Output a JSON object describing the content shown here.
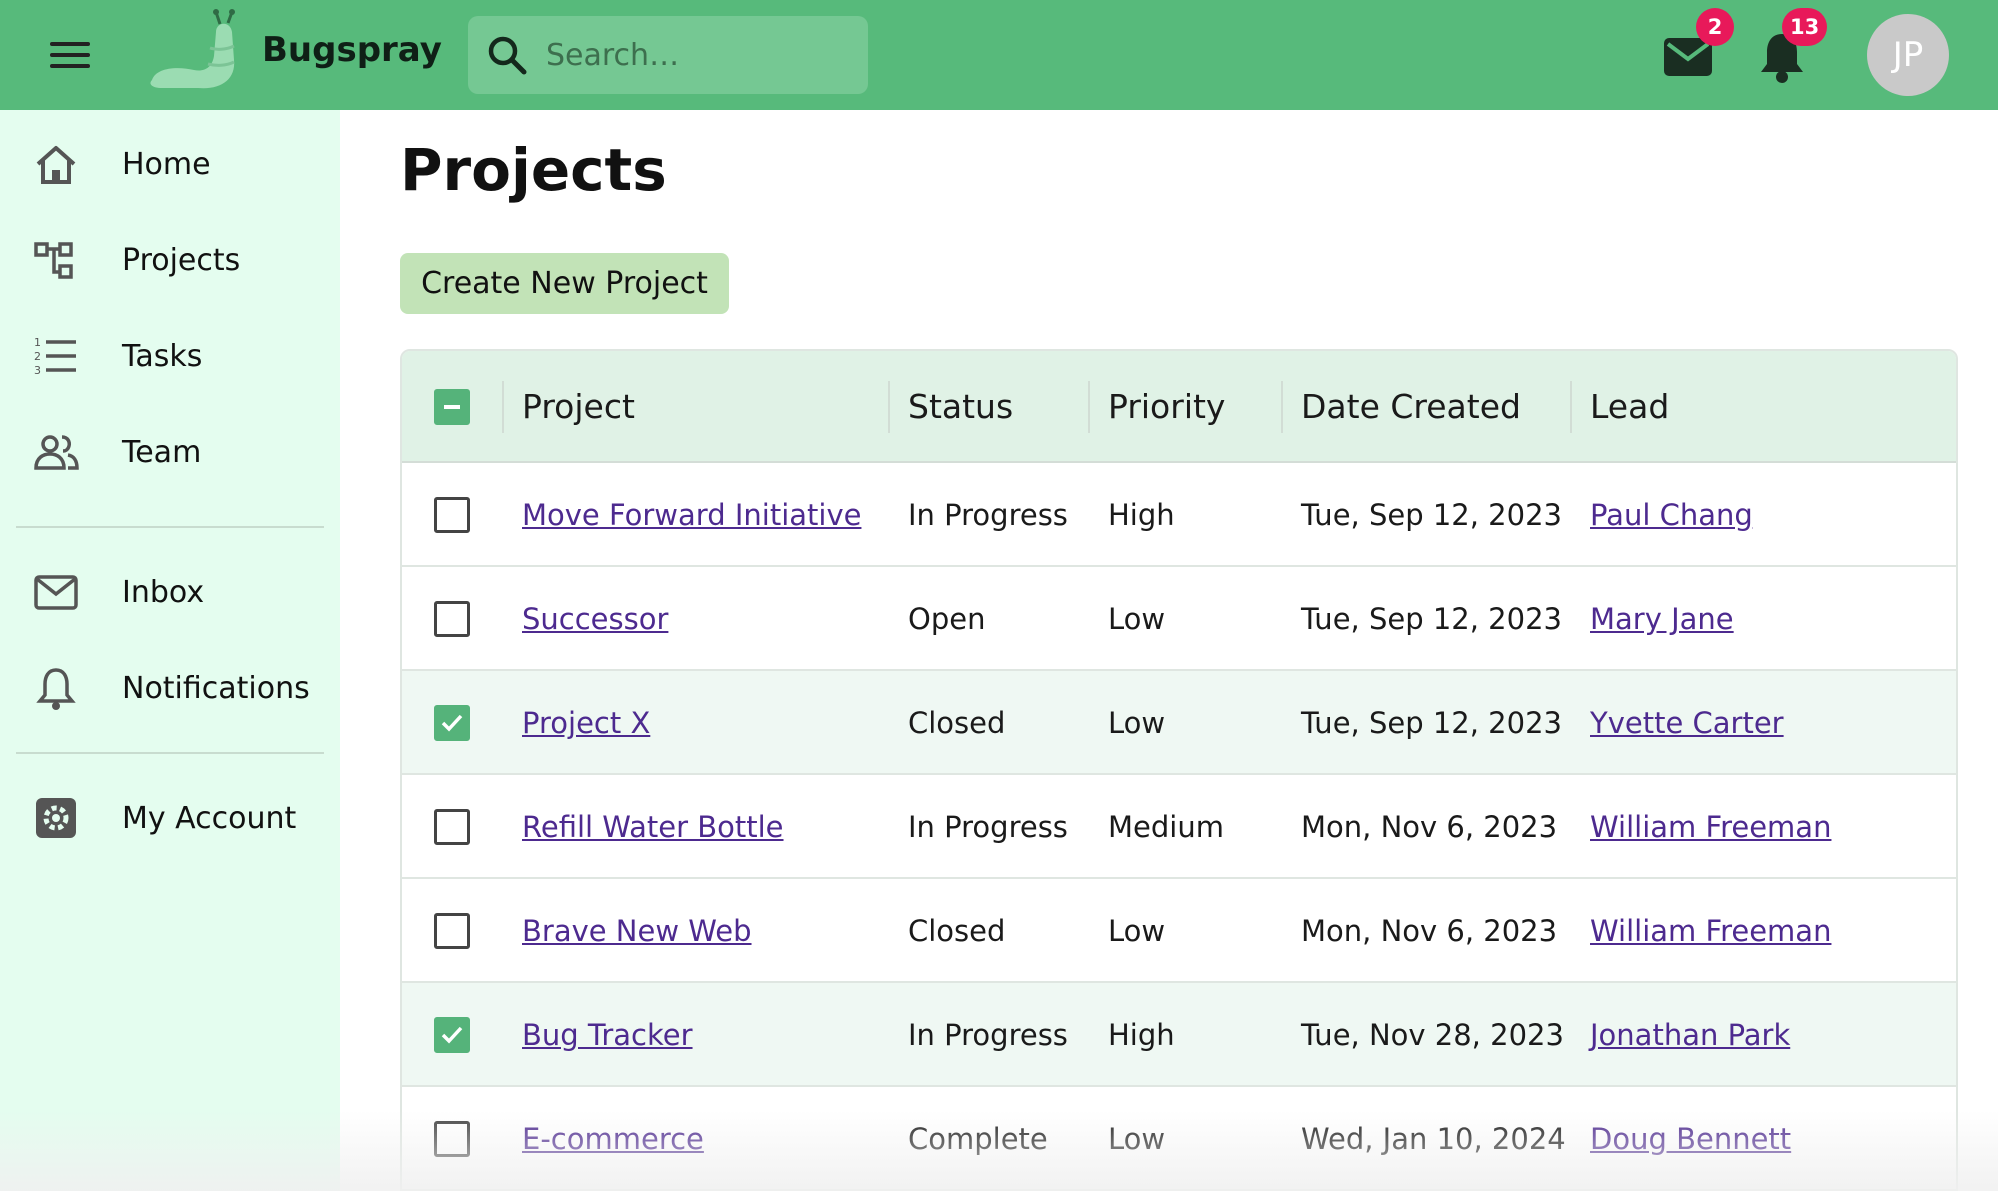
{
  "header": {
    "brand": "Bugspray",
    "search_placeholder": "Search…",
    "mail_count": "2",
    "notification_count": "13",
    "avatar_initials": "JP"
  },
  "sidebar": {
    "items": [
      {
        "label": "Home",
        "icon": "home-icon"
      },
      {
        "label": "Projects",
        "icon": "projects-icon"
      },
      {
        "label": "Tasks",
        "icon": "tasks-icon"
      },
      {
        "label": "Team",
        "icon": "team-icon"
      },
      {
        "label": "Inbox",
        "icon": "inbox-icon"
      },
      {
        "label": "Notifications",
        "icon": "bell-icon"
      },
      {
        "label": "My Account",
        "icon": "gear-icon"
      }
    ]
  },
  "main": {
    "title": "Projects",
    "create_label": "Create New Project"
  },
  "table": {
    "columns": [
      "Project",
      "Status",
      "Priority",
      "Date Created",
      "Lead"
    ],
    "rows": [
      {
        "project": "Move Forward Initiative",
        "status": "In Progress",
        "priority": "High",
        "date": "Tue, Sep 12, 2023",
        "lead": "Paul Chang",
        "checked": false
      },
      {
        "project": "Successor",
        "status": "Open",
        "priority": "Low",
        "date": "Tue, Sep 12, 2023",
        "lead": "Mary Jane",
        "checked": false
      },
      {
        "project": "Project X",
        "status": "Closed",
        "priority": "Low",
        "date": "Tue, Sep 12, 2023",
        "lead": "Yvette Carter",
        "checked": true
      },
      {
        "project": "Refill Water Bottle",
        "status": "In Progress",
        "priority": "Medium",
        "date": "Mon, Nov 6, 2023",
        "lead": "William Freeman",
        "checked": false
      },
      {
        "project": "Brave New Web",
        "status": "Closed",
        "priority": "Low",
        "date": "Mon, Nov 6, 2023",
        "lead": "William Freeman",
        "checked": false
      },
      {
        "project": "Bug Tracker",
        "status": "In Progress",
        "priority": "High",
        "date": "Tue, Nov 28, 2023",
        "lead": "Jonathan Park",
        "checked": true
      },
      {
        "project": "E-commerce",
        "status": "Complete",
        "priority": "Low",
        "date": "Wed, Jan 10, 2024",
        "lead": "Doug Bennett",
        "checked": false
      }
    ]
  },
  "colors": {
    "topbar": "#57ba7b",
    "sidebar": "#e4fdef",
    "accent": "#55b37a",
    "badge": "#e8195a",
    "link": "#4d2a8f"
  }
}
